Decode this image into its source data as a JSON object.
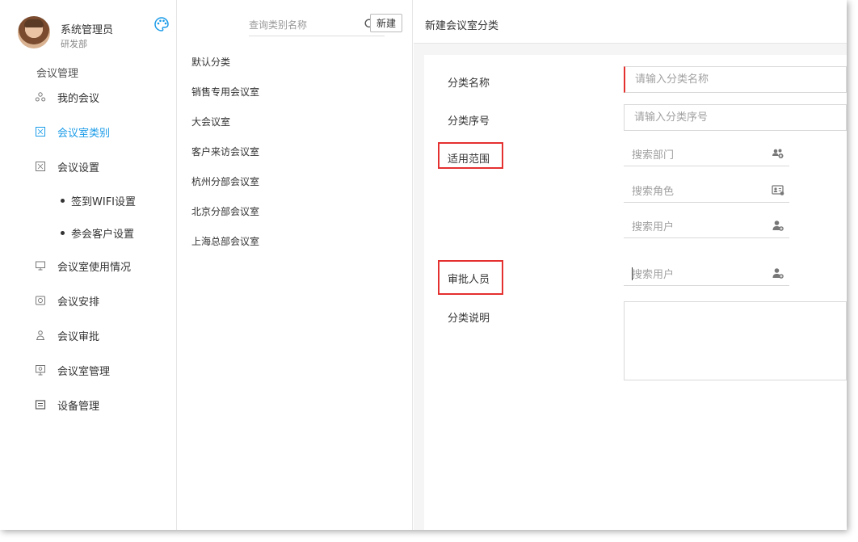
{
  "user": {
    "name": "系统管理员",
    "dept": "研发部"
  },
  "sidebar": {
    "section_title": "会议管理",
    "items": [
      {
        "label": "我的会议",
        "icon": "meeting-icon"
      },
      {
        "label": "会议室类别",
        "icon": "category-icon",
        "active": true
      },
      {
        "label": "会议设置",
        "icon": "settings-icon"
      },
      {
        "label": "会议室使用情况",
        "icon": "monitor-icon"
      },
      {
        "label": "会议安排",
        "icon": "schedule-icon"
      },
      {
        "label": "会议审批",
        "icon": "approval-icon"
      },
      {
        "label": "会议室管理",
        "icon": "room-icon"
      },
      {
        "label": "设备管理",
        "icon": "device-icon"
      }
    ],
    "sub_items": [
      {
        "label": "签到WIFI设置"
      },
      {
        "label": "参会客户设置"
      }
    ],
    "active_color": "#1a9be8"
  },
  "categories": {
    "search_placeholder": "查询类别名称",
    "new_label": "新建",
    "items": [
      "默认分类",
      "销售专用会议室",
      "大会议室",
      "客户来访会议室",
      "杭州分部会议室",
      "北京分部会议室",
      "上海总部会议室"
    ]
  },
  "form": {
    "header_title": "新建会议室分类",
    "name_label": "分类名称",
    "name_placeholder": "请输入分类名称",
    "order_label": "分类序号",
    "order_placeholder": "请输入分类序号",
    "scope_label": "适用范围",
    "scope_dept_placeholder": "搜索部门",
    "scope_role_placeholder": "搜索角色",
    "scope_user_placeholder": "搜索用户",
    "approver_label": "审批人员",
    "approver_placeholder": "搜索用户",
    "desc_label": "分类说明",
    "highlight_color": "#e53030"
  }
}
